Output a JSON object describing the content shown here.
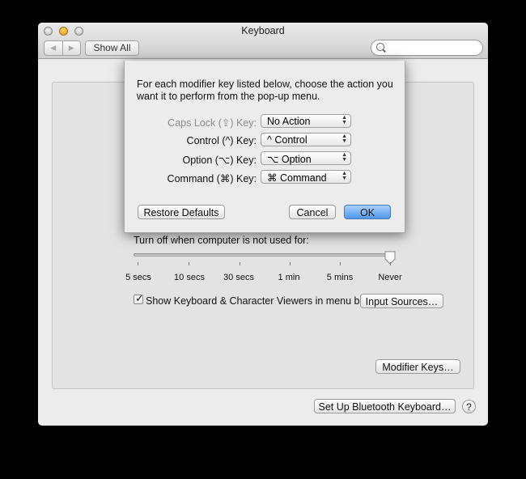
{
  "window": {
    "title": "Keyboard",
    "nav_back": "◀",
    "nav_forward": "▶",
    "show_all": "Show All",
    "search_placeholder": ""
  },
  "sheet": {
    "instructions": "For each modifier key listed below, choose the action you want it to perform from the pop-up menu.",
    "rows": [
      {
        "label": "Caps Lock (⇪) Key:",
        "value": "No Action",
        "dimmed": true
      },
      {
        "label": "Control (^) Key:",
        "value": "^ Control",
        "dimmed": false
      },
      {
        "label": "Option (⌥) Key:",
        "value": "⌥ Option",
        "dimmed": false
      },
      {
        "label": "Command (⌘) Key:",
        "value": "⌘ Command",
        "dimmed": false
      }
    ],
    "restore_defaults": "Restore Defaults",
    "cancel": "Cancel",
    "ok": "OK"
  },
  "backlight": {
    "turn_off_label": "Turn off when computer is not used for:",
    "ticks": [
      "5 secs",
      "10 secs",
      "30 secs",
      "1 min",
      "5 mins",
      "Never"
    ],
    "selected": "Never"
  },
  "viewers": {
    "checked": true,
    "label": "Show Keyboard & Character Viewers in menu bar",
    "input_sources": "Input Sources…"
  },
  "modifier_keys_button": "Modifier Keys…",
  "bluetooth_button": "Set Up Bluetooth Keyboard…",
  "help": "?",
  "colors": {
    "accent": "#5097ec",
    "background": "#000000",
    "window": "#ececec"
  }
}
